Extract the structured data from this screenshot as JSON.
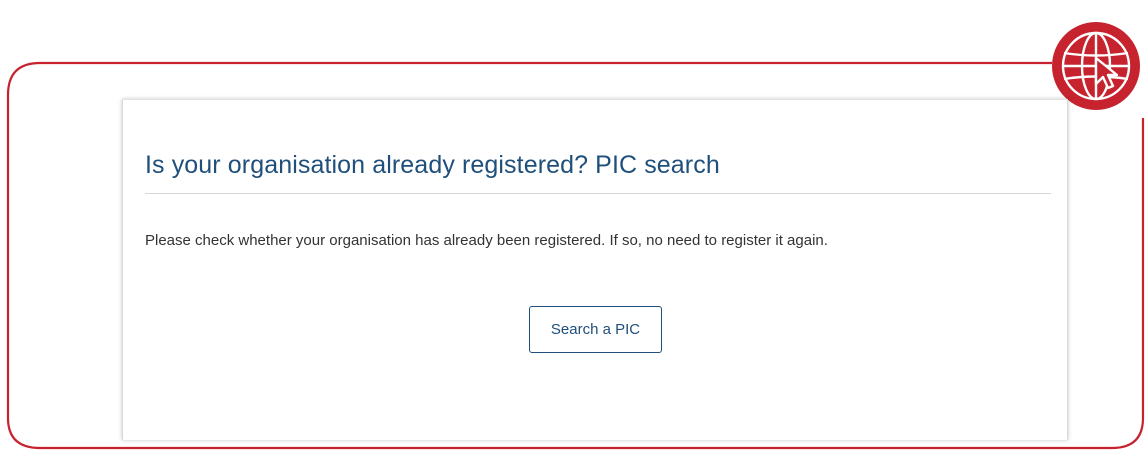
{
  "card": {
    "title": "Is your organisation already registered? PIC search",
    "description": "Please check whether your organisation has already been registered. If so, no need to register it again.",
    "search_button_label": "Search a PIC"
  },
  "icons": {
    "badge": "globe-cursor-icon"
  },
  "colors": {
    "frame_red": "#c6232e",
    "title_blue": "#1f4f7a",
    "text": "#333333",
    "divider": "#d6d6d6"
  }
}
